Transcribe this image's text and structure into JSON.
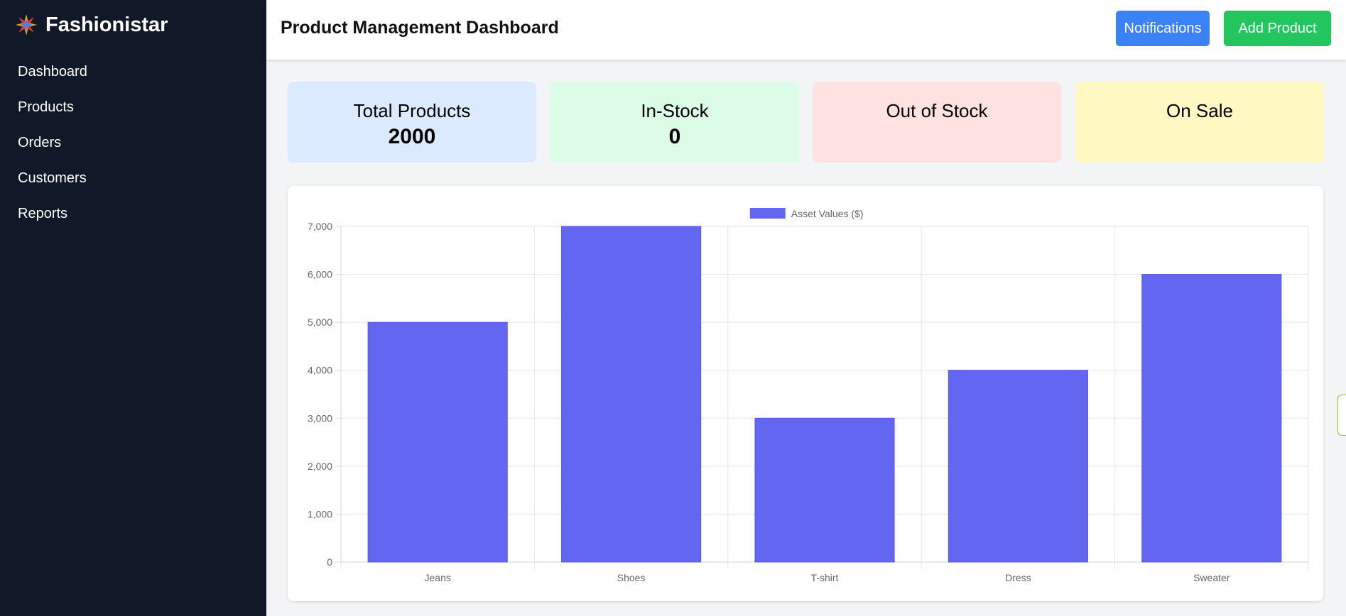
{
  "app": {
    "brand": "Fashionistar",
    "brand_icon": "star-burst-icon"
  },
  "sidebar": {
    "items": [
      {
        "label": "Dashboard"
      },
      {
        "label": "Products"
      },
      {
        "label": "Orders"
      },
      {
        "label": "Customers"
      },
      {
        "label": "Reports"
      }
    ]
  },
  "header": {
    "title": "Product Management Dashboard",
    "notifications_label": "Notifications",
    "add_product_label": "Add Product"
  },
  "cards": [
    {
      "title": "Total Products",
      "value": "2000",
      "bg": "#dbeafe"
    },
    {
      "title": "In-Stock",
      "value": "0",
      "bg": "#dcfce7"
    },
    {
      "title": "Out of Stock",
      "value": "",
      "bg": "#fee2e2"
    },
    {
      "title": "On Sale",
      "value": "",
      "bg": "#fef9c3"
    }
  ],
  "colors": {
    "sidebar_bg": "#111827",
    "notify_button": "#3b82f6",
    "add_button": "#22c55e",
    "bar_fill": "#6366f1"
  },
  "chart_data": {
    "type": "bar",
    "categories": [
      "Jeans",
      "Shoes",
      "T-shirt",
      "Dress",
      "Sweater"
    ],
    "series": [
      {
        "name": "Asset Values ($)",
        "values": [
          5000,
          7000,
          3000,
          4000,
          6000
        ],
        "color": "#6366f1"
      }
    ],
    "ylim": [
      0,
      7000
    ],
    "yticks": [
      0,
      1000,
      2000,
      3000,
      4000,
      5000,
      6000,
      7000
    ],
    "ytick_labels": [
      "0",
      "1,000",
      "2,000",
      "3,000",
      "4,000",
      "5,000",
      "6,000",
      "7,000"
    ],
    "grid": true,
    "legend": "top-center"
  }
}
